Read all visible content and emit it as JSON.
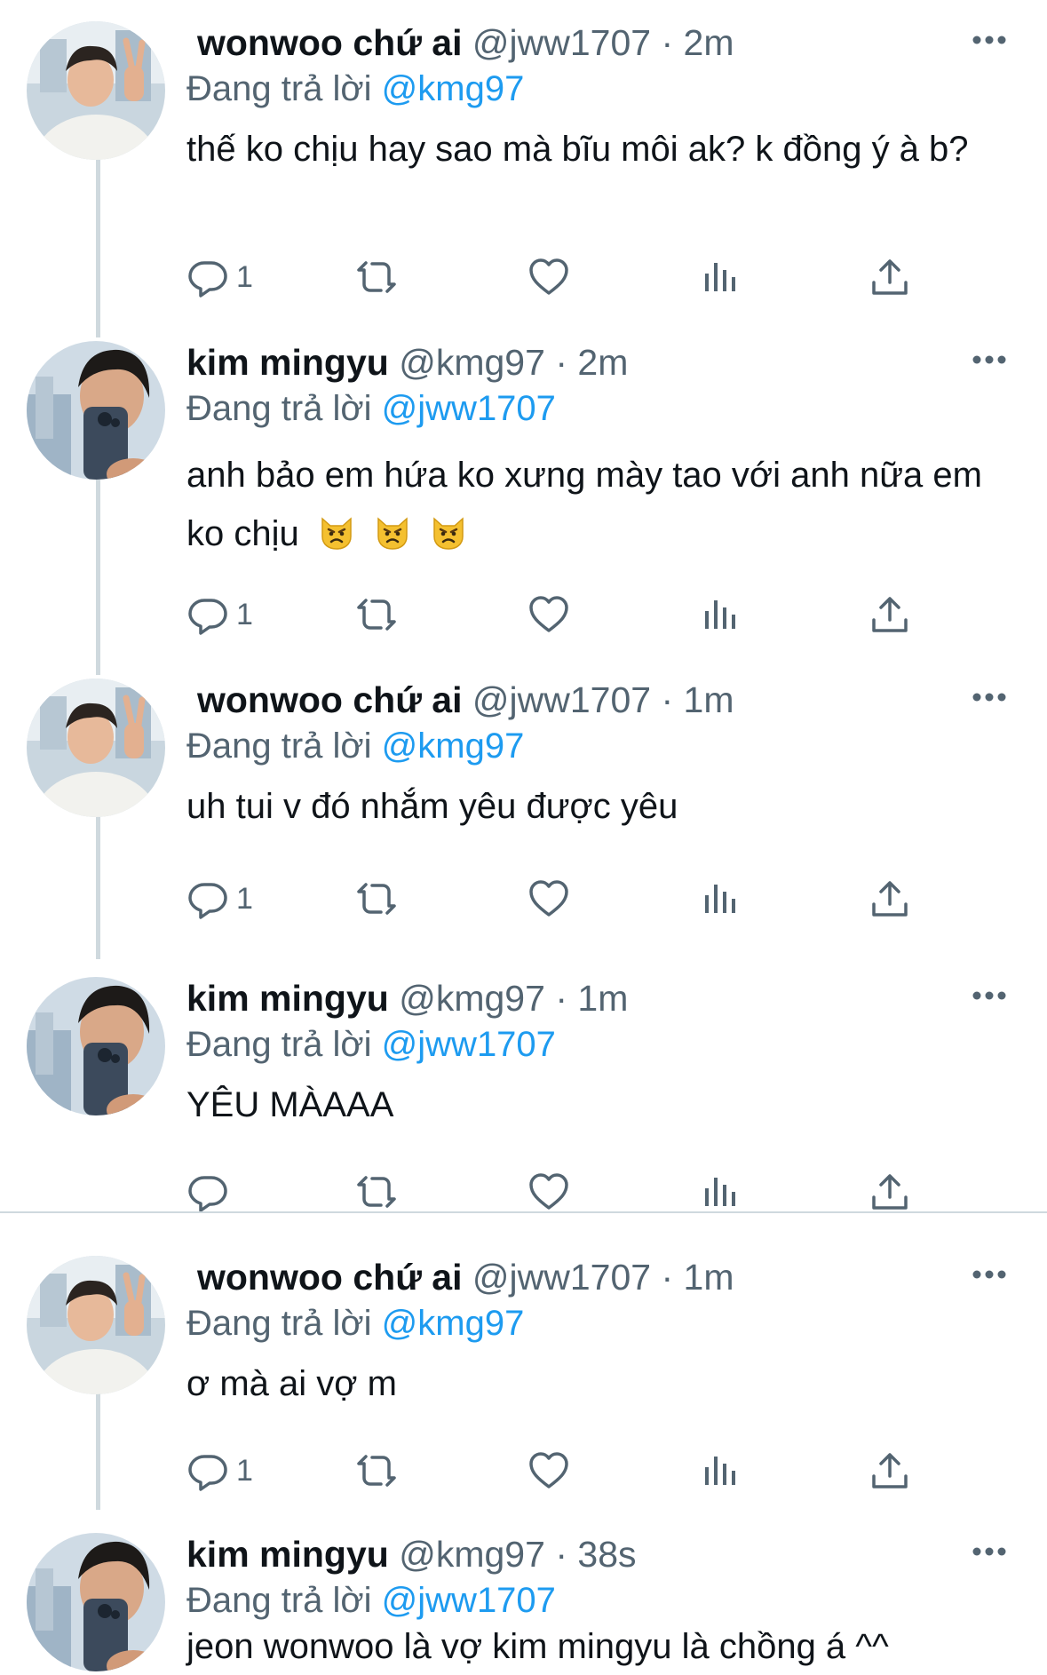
{
  "reply_prefix": "Đang trả lời",
  "tweets": [
    {
      "name": "wonwoo chứ ai",
      "handle": "@jww1707",
      "dot": "·",
      "time": "2m",
      "reply_to": "@kmg97",
      "text": "thế ko chịu hay sao mà bĩu môi ak? k đồng ý à b?",
      "reply_count": "1",
      "avatar": "wonwoo-avatar"
    },
    {
      "name": "kim mingyu",
      "handle": "@kmg97",
      "dot": "·",
      "time": "2m",
      "reply_to": "@jww1707",
      "text": "anh bảo em hứa ko xưng mày tao với anh nữa em ko chịu",
      "emoji": [
        "pouting-cat-emoji",
        "pouting-cat-emoji",
        "pouting-cat-emoji"
      ],
      "reply_count": "1",
      "avatar": "mingyu-avatar"
    },
    {
      "name": "wonwoo chứ ai",
      "handle": "@jww1707",
      "dot": "·",
      "time": "1m",
      "reply_to": "@kmg97",
      "text": "uh tui v đó nhắm yêu được yêu",
      "reply_count": "1",
      "avatar": "wonwoo-avatar"
    },
    {
      "name": "kim mingyu",
      "handle": "@kmg97",
      "dot": "·",
      "time": "1m",
      "reply_to": "@jww1707",
      "text": "YÊU MÀAAA",
      "reply_count": "",
      "avatar": "mingyu-avatar"
    },
    {
      "name": "wonwoo chứ ai",
      "handle": "@jww1707",
      "dot": "·",
      "time": "1m",
      "reply_to": "@kmg97",
      "text": "ơ mà ai vợ m",
      "reply_count": "1",
      "avatar": "wonwoo-avatar"
    },
    {
      "name": "kim mingyu",
      "handle": "@kmg97",
      "dot": "·",
      "time": "38s",
      "reply_to": "@jww1707",
      "text": "jeon wonwoo là vợ kim mingyu là chồng á ^^",
      "reply_count": "",
      "avatar": "mingyu-avatar"
    }
  ],
  "colors": {
    "accent": "#1d9bf0",
    "muted": "#536471",
    "text": "#0f1419",
    "divider": "#cfd9de"
  },
  "icons": [
    "reply-icon",
    "retweet-icon",
    "like-icon",
    "views-icon",
    "share-icon",
    "more-icon"
  ]
}
